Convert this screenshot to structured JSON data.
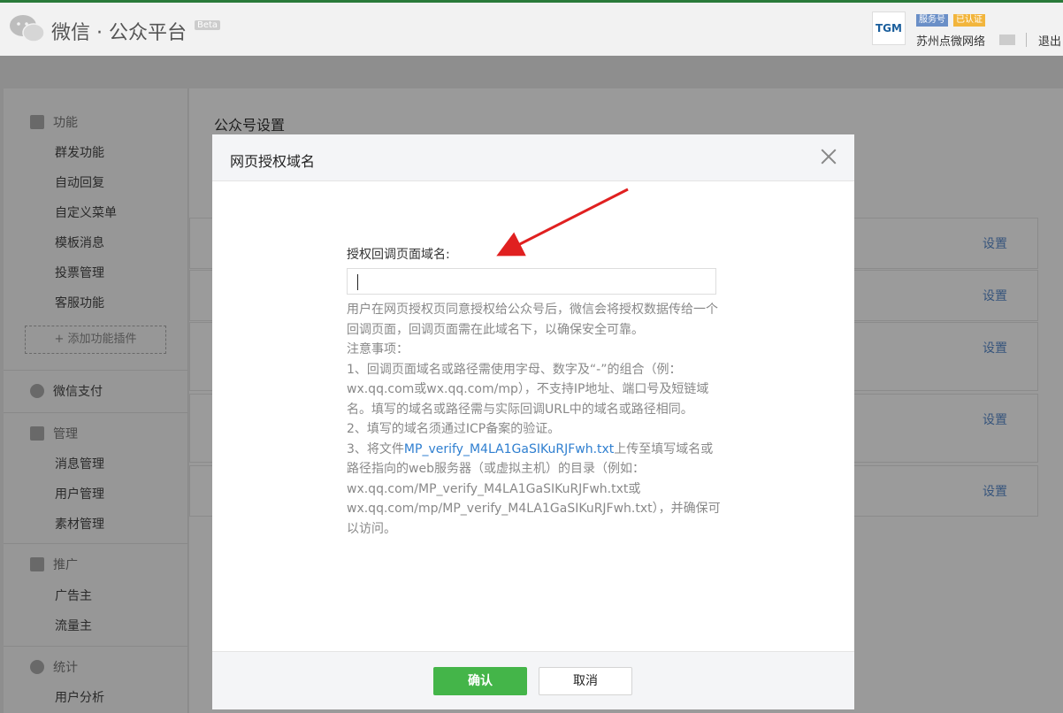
{
  "header": {
    "brand": "微信 · 公众平台",
    "beta": "Beta",
    "account_avatar_text": "TGM",
    "tag_service": "服务号",
    "tag_verified": "已认证",
    "account_name": "苏州点微网络",
    "logout": "退出"
  },
  "sidebar": {
    "groups": [
      {
        "label": "功能",
        "items": [
          "群发功能",
          "自动回复",
          "自定义菜单",
          "模板消息",
          "投票管理",
          "客服功能"
        ]
      },
      {
        "label": "微信支付",
        "items": []
      },
      {
        "label": "管理",
        "items": [
          "消息管理",
          "用户管理",
          "素材管理"
        ]
      },
      {
        "label": "推广",
        "items": [
          "广告主",
          "流量主"
        ]
      },
      {
        "label": "统计",
        "items": [
          "用户分析"
        ]
      }
    ],
    "add_plugin": "+ 添加功能插件"
  },
  "main": {
    "title": "公众号设置",
    "row_link": "设置"
  },
  "dialog": {
    "title": "网页授权域名",
    "field_label": "授权回调页面域名:",
    "field_value": "",
    "desc": {
      "p1": "用户在网页授权页同意授权给公众号后，微信会将授权数据传给一个回调页面，回调页面需在此域名下，以确保安全可靠。",
      "notice": "注意事项：",
      "item1": "1、回调页面域名或路径需使用字母、数字及“-”的组合（例：wx.qq.com或wx.qq.com/mp），不支持IP地址、端口号及短链域名。填写的域名或路径需与实际回调URL中的域名或路径相同。",
      "item2": "2、填写的域名须通过ICP备案的验证。",
      "item3_prefix": "3、将文件",
      "item3_file": "MP_verify_M4LA1GaSIKuRJFwh.txt",
      "item3_suffix": "上传至填写域名或路径指向的web服务器（或虚拟主机）的目录（例如：wx.qq.com/MP_verify_M4LA1GaSIKuRJFwh.txt或wx.qq.com/mp/MP_verify_M4LA1GaSIKuRJFwh.txt），并确保可以访问。"
    },
    "confirm": "确认",
    "cancel": "取消"
  },
  "colors": {
    "accent_green": "#44b549",
    "link_blue": "#2f7fd0",
    "annotation_red": "#e02020"
  }
}
